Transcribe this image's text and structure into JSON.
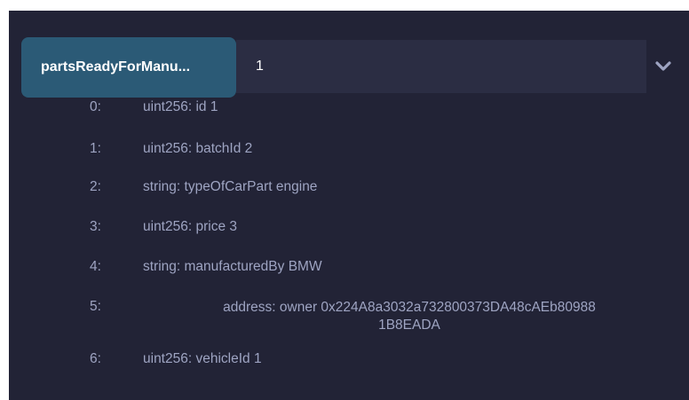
{
  "function_call": {
    "button_label": "partsReadyForManu...",
    "input_value": "1",
    "expand_icon": "chevron-down-icon"
  },
  "outputs": [
    {
      "index": "0:",
      "value": "uint256: id 1"
    },
    {
      "index": "1:",
      "value": "uint256: batchId 2"
    },
    {
      "index": "2:",
      "value": "string: typeOfCarPart engine"
    },
    {
      "index": "3:",
      "value": "uint256: price 3"
    },
    {
      "index": "4:",
      "value": "string: manufacturedBy BMW"
    },
    {
      "index": "5:",
      "value_line1": "address: owner 0x224A8a3032a732800373DA48cAEb80988",
      "value_line2": "1B8EADA"
    },
    {
      "index": "6:",
      "value": "uint256: vehicleId 1"
    }
  ],
  "colors": {
    "panel_background": "#222336",
    "button_background": "#2b5a76",
    "input_background": "#2b2d43",
    "output_text": "#9ea4c2",
    "chevron": "#9ea4c2"
  }
}
